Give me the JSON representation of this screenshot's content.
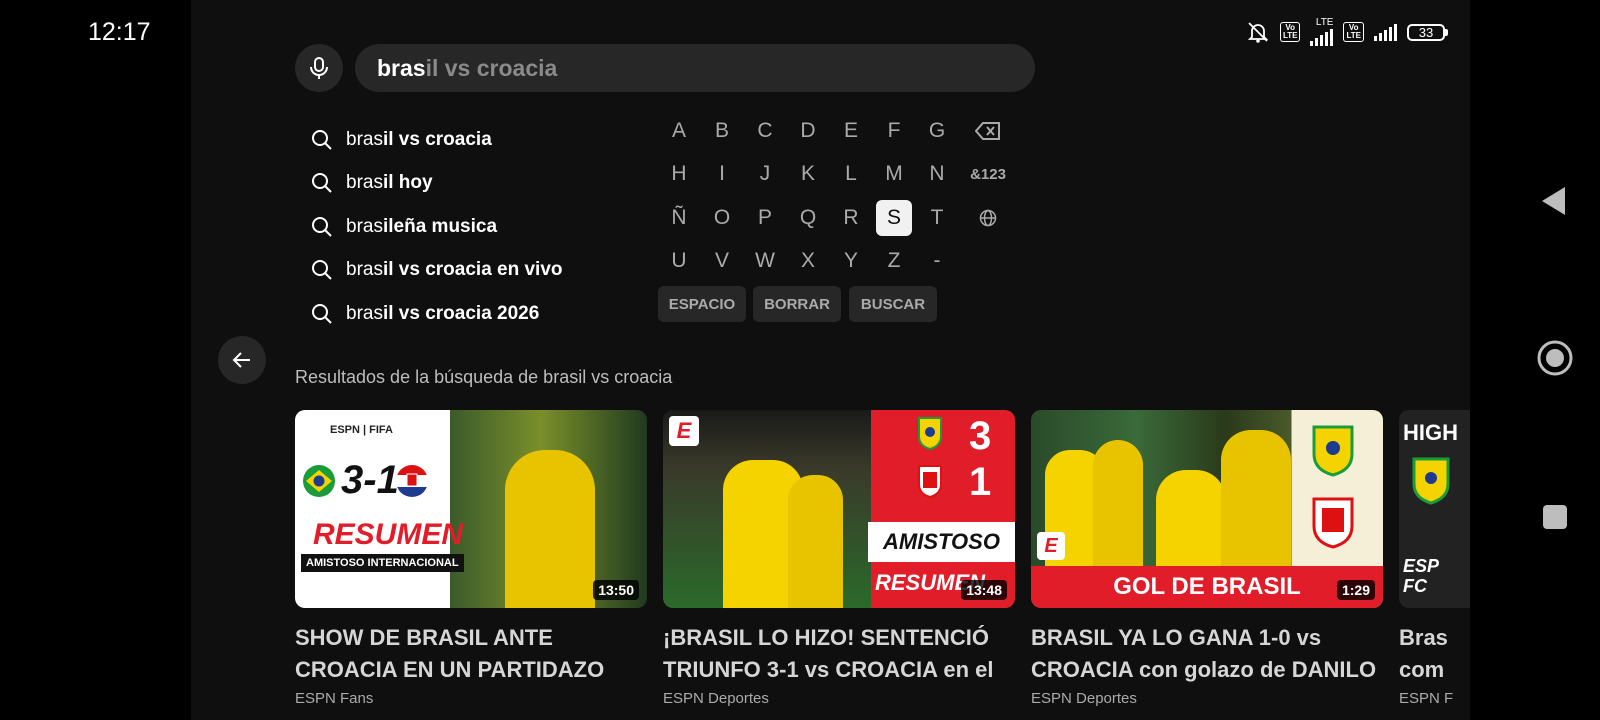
{
  "status": {
    "time": "12:17",
    "battery": "33",
    "lte": "LTE",
    "volte": "Vo\nLTE"
  },
  "search": {
    "typed": "bras",
    "completion": "il vs croacia"
  },
  "suggestions": [
    {
      "prefix": "bras",
      "suffix": "il vs croacia"
    },
    {
      "prefix": "bras",
      "suffix": "il hoy"
    },
    {
      "prefix": "bras",
      "suffix": "ileña musica"
    },
    {
      "prefix": "bras",
      "suffix": "il vs croacia en vivo"
    },
    {
      "prefix": "bras",
      "suffix": "il vs croacia 2026"
    }
  ],
  "keyboard": {
    "rows": [
      [
        "A",
        "B",
        "C",
        "D",
        "E",
        "F",
        "G"
      ],
      [
        "H",
        "I",
        "J",
        "K",
        "L",
        "M",
        "N"
      ],
      [
        "Ñ",
        "O",
        "P",
        "Q",
        "R",
        "S",
        "T"
      ],
      [
        "U",
        "V",
        "W",
        "X",
        "Y",
        "Z",
        "-"
      ]
    ],
    "selected_key": "S",
    "symbols_key": "&123",
    "actions": {
      "space": "ESPACIO",
      "delete": "BORRAR",
      "search": "BUSCAR"
    }
  },
  "results_heading": "Resultados de la búsqueda de brasil vs croacia",
  "videos": [
    {
      "title": "SHOW DE BRASIL ANTE CROACIA EN UN PARTIDAZO",
      "channel": "ESPN Fans",
      "duration": "13:50",
      "thumb": {
        "brand": "ESPN | FIFA",
        "score": "3-1",
        "banner": "RESUMEN",
        "sub": "AMISTOSO INTERNACIONAL"
      }
    },
    {
      "title": "¡BRASIL LO HIZO! SENTENCIÓ TRIUNFO 3-1 vs CROACIA en el",
      "channel": "ESPN Deportes",
      "duration": "13:48",
      "thumb": {
        "score_home": "3",
        "score_away": "1",
        "banner": "AMISTOSO",
        "sub": "RESUMEN"
      }
    },
    {
      "title": "BRASIL YA LO GANA 1-0 vs CROACIA con golazo de DANILO",
      "channel": "ESPN Deportes",
      "duration": "1:29",
      "thumb": {
        "banner": "GOL DE BRASIL"
      }
    },
    {
      "title": "Bras com",
      "channel": "ESPN F",
      "duration": "",
      "thumb": {
        "top": "HIGH",
        "bottom": "ESP FC"
      }
    }
  ],
  "colors": {
    "app_bg": "#0f0f0f",
    "surface": "#272727",
    "accent_red": "#e11d2a",
    "brazil_yellow": "#f5d300"
  }
}
